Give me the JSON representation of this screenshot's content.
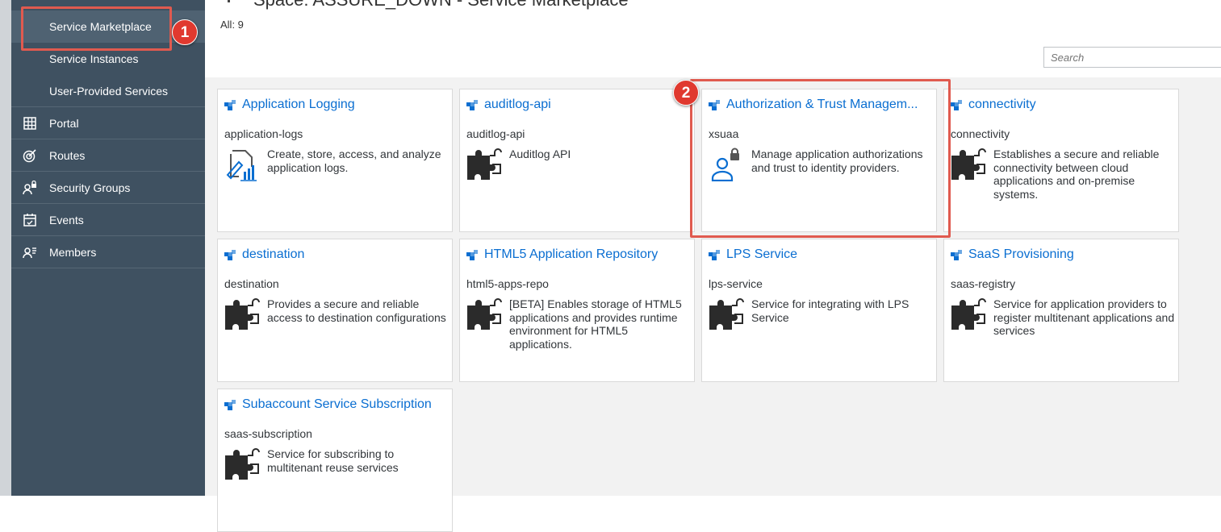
{
  "sidebar": {
    "items": [
      {
        "label": "Service Marketplace",
        "icon": ""
      },
      {
        "label": "Service Instances",
        "icon": ""
      },
      {
        "label": "User-Provided Services",
        "icon": ""
      },
      {
        "label": "Portal",
        "icon": "grid-icon"
      },
      {
        "label": "Routes",
        "icon": "target-icon"
      },
      {
        "label": "Security Groups",
        "icon": "user-lock-icon"
      },
      {
        "label": "Events",
        "icon": "calendar-icon"
      },
      {
        "label": "Members",
        "icon": "members-icon"
      }
    ]
  },
  "callouts": {
    "first": "1",
    "second": "2"
  },
  "header": {
    "title": "Space: ASSURE_DOWN - Service Marketplace",
    "count": "All: 9"
  },
  "search": {
    "placeholder": "Search"
  },
  "tiles": [
    {
      "title": "Application Logging",
      "name": "application-logs",
      "description": "Create, store, access, and analyze application logs.",
      "icon": "logging-icon"
    },
    {
      "title": "auditlog-api",
      "name": "auditlog-api",
      "description": "Auditlog API",
      "icon": "puzzle-icon"
    },
    {
      "title": "Authorization & Trust Managem...",
      "name": "xsuaa",
      "description": "Manage application authorizations and trust to identity providers.",
      "icon": "user-lock-icon"
    },
    {
      "title": "connectivity",
      "name": "connectivity",
      "description": "Establishes a secure and reliable connectivity between cloud applications and on-premise systems.",
      "icon": "puzzle-icon"
    },
    {
      "title": "destination",
      "name": "destination",
      "description": "Provides a secure and reliable access to destination configurations",
      "icon": "puzzle-icon"
    },
    {
      "title": "HTML5 Application Repository",
      "name": "html5-apps-repo",
      "description": "[BETA] Enables storage of HTML5 applications and provides runtime environment for HTML5 applications.",
      "icon": "puzzle-icon"
    },
    {
      "title": "LPS Service",
      "name": "lps-service",
      "description": "Service for integrating with LPS Service",
      "icon": "puzzle-icon"
    },
    {
      "title": "SaaS Provisioning",
      "name": "saas-registry",
      "description": "Service for application providers to register multitenant applications and services",
      "icon": "puzzle-icon"
    },
    {
      "title": "Subaccount Service Subscription",
      "name": "saas-subscription",
      "description": "Service for subscribing to multitenant reuse services",
      "icon": "puzzle-icon"
    }
  ],
  "colors": {
    "sidebar": "#3f5161",
    "link": "#0a6ed1",
    "callout": "#e05a4f",
    "badge": "#e0392f"
  }
}
